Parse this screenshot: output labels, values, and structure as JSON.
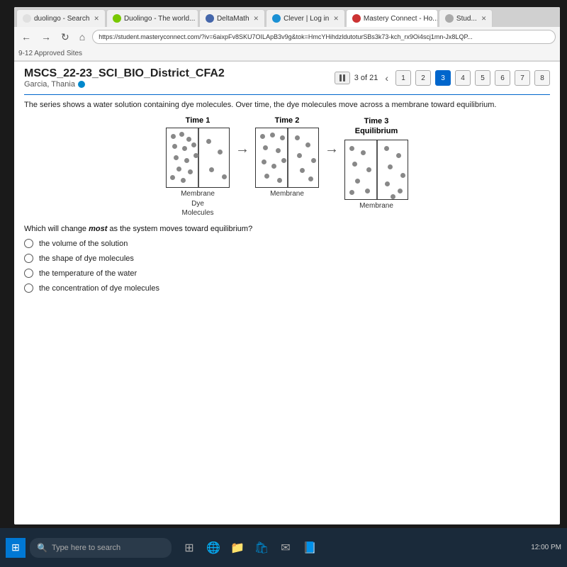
{
  "browser": {
    "tabs": [
      {
        "id": "t1",
        "label": "duolingo - Search",
        "active": false,
        "icon_color": "#e0e0e0"
      },
      {
        "id": "t2",
        "label": "Duolingo - The world...",
        "active": false,
        "icon_color": "#78c800"
      },
      {
        "id": "t3",
        "label": "DeltaMath",
        "active": false,
        "icon_color": "#4466aa"
      },
      {
        "id": "t4",
        "label": "Clever | Log in",
        "active": false,
        "icon_color": "#1a90d4"
      },
      {
        "id": "t5",
        "label": "Mastery Connect - Ho...",
        "active": true,
        "icon_color": "#cc3333"
      },
      {
        "id": "t6",
        "label": "Stud...",
        "active": false,
        "icon_color": "#aaaaaa"
      }
    ],
    "address": "https://student.masteryconnect.com/?iv=6aixpFv8SKU7OILApB3v9g&tok=HmcYHihdzldutoturSBs3k73-kch_rx9Oi4scj1mn-Jx8LQP..."
  },
  "bookmarks": {
    "label": "9-12 Approved Sites"
  },
  "page": {
    "title": "MSCS_22-23_SCI_BIO_District_CFA2",
    "student": "Garcia, Thania",
    "question_count": "3 of 21",
    "question_numbers": [
      "1",
      "2",
      "3",
      "4",
      "5",
      "6",
      "7",
      "8"
    ],
    "active_question": "3",
    "description": "The series shows a water solution containing dye molecules. Over time, the dye molecules move across a membrane toward equilibrium.",
    "time_labels": [
      "Time 1",
      "Time 2",
      "Time 3\nEquilibrium"
    ],
    "membrane_labels": [
      "Membrane",
      "Membrane",
      "Membrane"
    ],
    "dye_label_line1": "Dye",
    "dye_label_line2": "Molecules",
    "question_prompt": "Which will change most as the system moves toward equilibrium?",
    "question_prompt_italic": "most",
    "answer_options": [
      "the volume of the solution",
      "the shape of dye molecules",
      "the temperature of the water",
      "the concentration of dye molecules"
    ]
  },
  "taskbar": {
    "search_placeholder": "Type here to search",
    "icons": [
      "⊞",
      "🔍",
      "📁",
      "🛒",
      "✉",
      "📘"
    ]
  }
}
